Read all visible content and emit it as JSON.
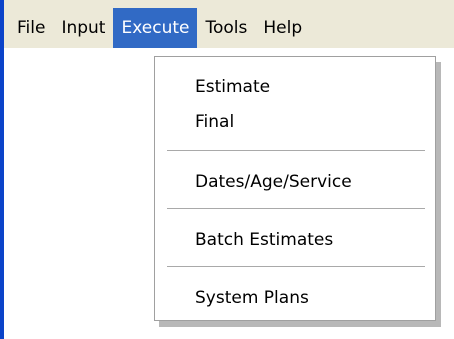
{
  "menubar": {
    "items": [
      {
        "label": "File"
      },
      {
        "label": "Input"
      },
      {
        "label": "Execute"
      },
      {
        "label": "Tools"
      },
      {
        "label": "Help"
      }
    ],
    "active_item": "Execute"
  },
  "execute_menu": {
    "items": [
      {
        "label": "Estimate"
      },
      {
        "label": "Final"
      },
      {
        "label": "Dates/Age/Service"
      },
      {
        "label": "Batch Estimates"
      },
      {
        "label": "System Plans"
      }
    ]
  },
  "colors": {
    "menubar_bg": "#ece9d8",
    "highlight": "#316ac5",
    "window_border": "#0b43c9"
  }
}
